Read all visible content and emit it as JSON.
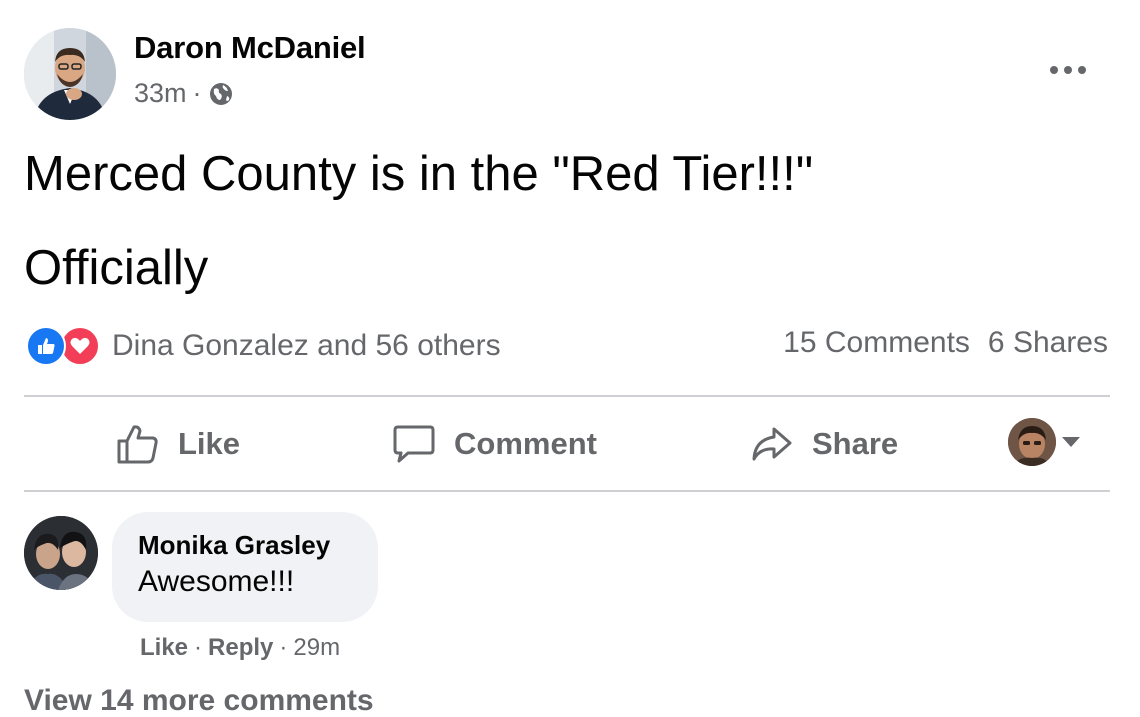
{
  "post": {
    "author": "Daron McDaniel",
    "time": "33m",
    "separator": "·",
    "privacy_icon": "globe-icon",
    "more_icon": "more-dots-icon",
    "text_line1": "Merced County is in the \"Red Tier!!!\"",
    "text_line2": "Officially"
  },
  "reactions": {
    "icons": [
      "like-reaction-icon",
      "love-reaction-icon"
    ],
    "summary": "Dina Gonzalez and 56 others",
    "comments_count": "15 Comments",
    "shares_count": "6 Shares"
  },
  "actions": {
    "like_label": "Like",
    "comment_label": "Comment",
    "share_label": "Share"
  },
  "comment": {
    "author": "Monika Grasley",
    "text": "Awesome!!!",
    "like_label": "Like",
    "reply_label": "Reply",
    "separator": "·",
    "time": "29m"
  },
  "view_more": "View 14 more comments",
  "colors": {
    "like_blue": "#1877f2",
    "love_red": "#f33e58",
    "secondary_text": "#65676b",
    "bubble_bg": "#f0f2f5"
  }
}
